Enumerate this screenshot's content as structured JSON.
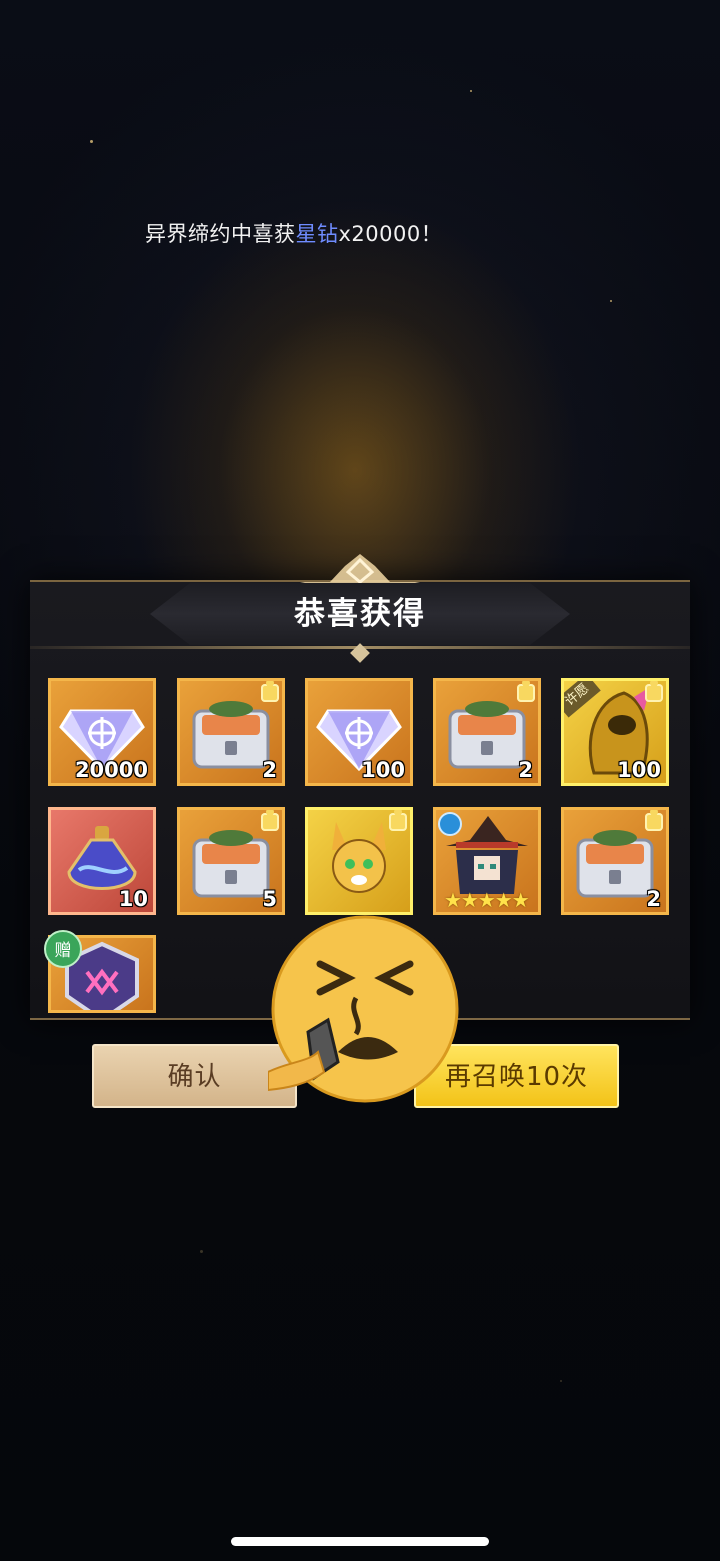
{
  "ticker": {
    "prefix": "异界缔约中喜获",
    "highlight": "星钻",
    "suffix": "x20000！"
  },
  "panel": {
    "title": "恭喜获得"
  },
  "rewards": [
    {
      "icon": "star-diamond-icon",
      "quantity": "20000"
    },
    {
      "icon": "treasure-chest-icon",
      "quantity": "2"
    },
    {
      "icon": "star-diamond-icon",
      "quantity": "100"
    },
    {
      "icon": "treasure-chest-icon",
      "quantity": "2"
    },
    {
      "icon": "golden-hero-icon",
      "quantity": "100",
      "tag": "许愿"
    },
    {
      "icon": "potion-bottle-icon",
      "quantity": "10"
    },
    {
      "icon": "treasure-chest-icon",
      "quantity": "5"
    },
    {
      "icon": "fox-pet-icon"
    },
    {
      "icon": "witch-hero-icon",
      "stars": 5
    },
    {
      "icon": "treasure-chest-icon",
      "quantity": "2"
    },
    {
      "icon": "guild-badge-icon",
      "tag": "赠"
    }
  ],
  "buttons": {
    "confirm": "确认",
    "summon_again": "再召唤10次"
  },
  "colors": {
    "highlight": "#6f8cff",
    "confirm_button": "#dcc39c",
    "summon_button": "#f6cf2c",
    "tile_border": "#f4b64a"
  }
}
